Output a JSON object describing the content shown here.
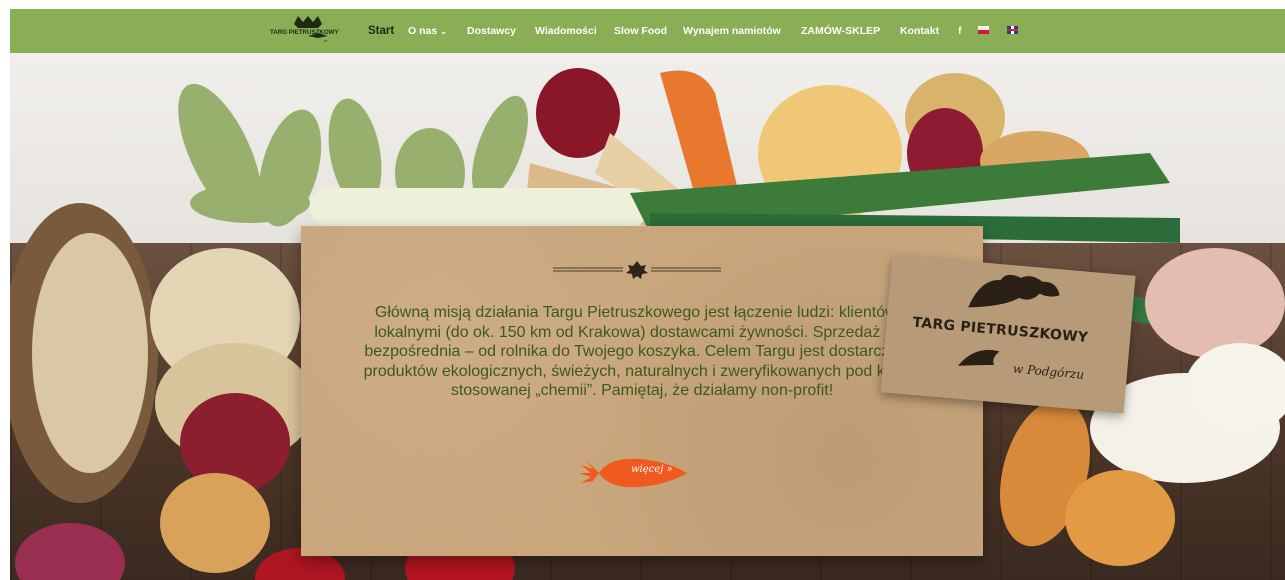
{
  "brand": {
    "logo_text": "TARG PIETRUSZKOWY",
    "label_line1": "TARG PIETRUSZKOWY",
    "label_line2": "w Podgórzu"
  },
  "nav": {
    "items": [
      {
        "label": "Start",
        "active": true
      },
      {
        "label": "O nas",
        "dropdown": true
      },
      {
        "label": "Dostawcy"
      },
      {
        "label": "Wiadomości"
      },
      {
        "label": "Slow Food"
      },
      {
        "label": "Wynajem namiotów"
      },
      {
        "label": "ZAMÓW-SKLEP"
      },
      {
        "label": "Kontakt"
      },
      {
        "label": "f",
        "icon": "facebook-icon"
      }
    ],
    "languages": [
      {
        "code": "pl",
        "icon": "flag-pl-icon"
      },
      {
        "code": "en",
        "icon": "flag-uk-icon"
      }
    ]
  },
  "hero": {
    "mission_text": "Główną misją działania Targu Pietruszkowego jest łączenie ludzi: klientów z lokalnymi (do ok. 150 km od Krakowa) dostawcami żywności. Sprzedaż jest bezpośrednia – od rolnika do Twojego koszyka. Celem Targu jest dostarczanie produktów ekologicznych, świeżych, naturalnych i zweryfikowanych pod kątem stosowanej „chemii”. Pamiętaj, że działamy non-profit!",
    "more_label": "więcej »"
  },
  "colors": {
    "nav_bg": "#8aae55",
    "mission_text": "#3c5a1a",
    "carrot": "#f05a1e",
    "card": "#c9a67c"
  }
}
